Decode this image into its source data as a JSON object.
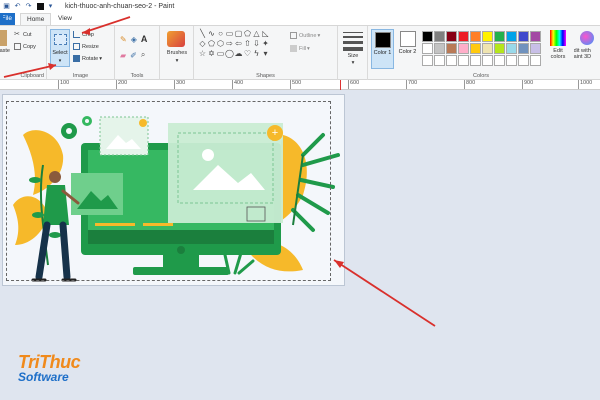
{
  "window": {
    "title": "kich-thuoc-anh-chuan-seo-2 - Paint"
  },
  "menu": {
    "file": "File",
    "home": "Home",
    "view": "View"
  },
  "ribbon": {
    "clipboard": {
      "label": "Clipboard",
      "paste": "Paste",
      "cut": "Cut",
      "copy": "Copy"
    },
    "image": {
      "label": "Image",
      "select": "Select",
      "crop": "Crop",
      "resize": "Resize",
      "rotate": "Rotate"
    },
    "tools": {
      "label": "Tools"
    },
    "brushes": {
      "label": "Brushes"
    },
    "shapes": {
      "label": "Shapes",
      "outline": "Outline",
      "fill": "Fill"
    },
    "size": {
      "label": "Size"
    },
    "colors": {
      "label": "Colors",
      "color1": "Color 1",
      "color2": "Color 2",
      "edit_colors": "Edit colors",
      "edit_with_paint3d": "Edit with Paint 3D"
    }
  },
  "ruler": {
    "ticks": [
      "100",
      "200",
      "300",
      "400",
      "500",
      "600",
      "700",
      "800",
      "900",
      "1000"
    ]
  },
  "palette": [
    "#000000",
    "#7f7f7f",
    "#880015",
    "#ed1c24",
    "#ff7f27",
    "#fff200",
    "#22b14c",
    "#00a2e8",
    "#3f48cc",
    "#a349a4",
    "#ffffff",
    "#c3c3c3",
    "#b97a57",
    "#ffaec9",
    "#ffc90e",
    "#efe4b0",
    "#b5e61d",
    "#99d9ea",
    "#7092be",
    "#c8bfe7",
    "#ffffff",
    "#ffffff",
    "#ffffff",
    "#ffffff",
    "#ffffff",
    "#ffffff",
    "#ffffff",
    "#ffffff",
    "#ffffff",
    "#ffffff"
  ],
  "watermark": {
    "line1": "TriThuc",
    "line2": "Software"
  }
}
